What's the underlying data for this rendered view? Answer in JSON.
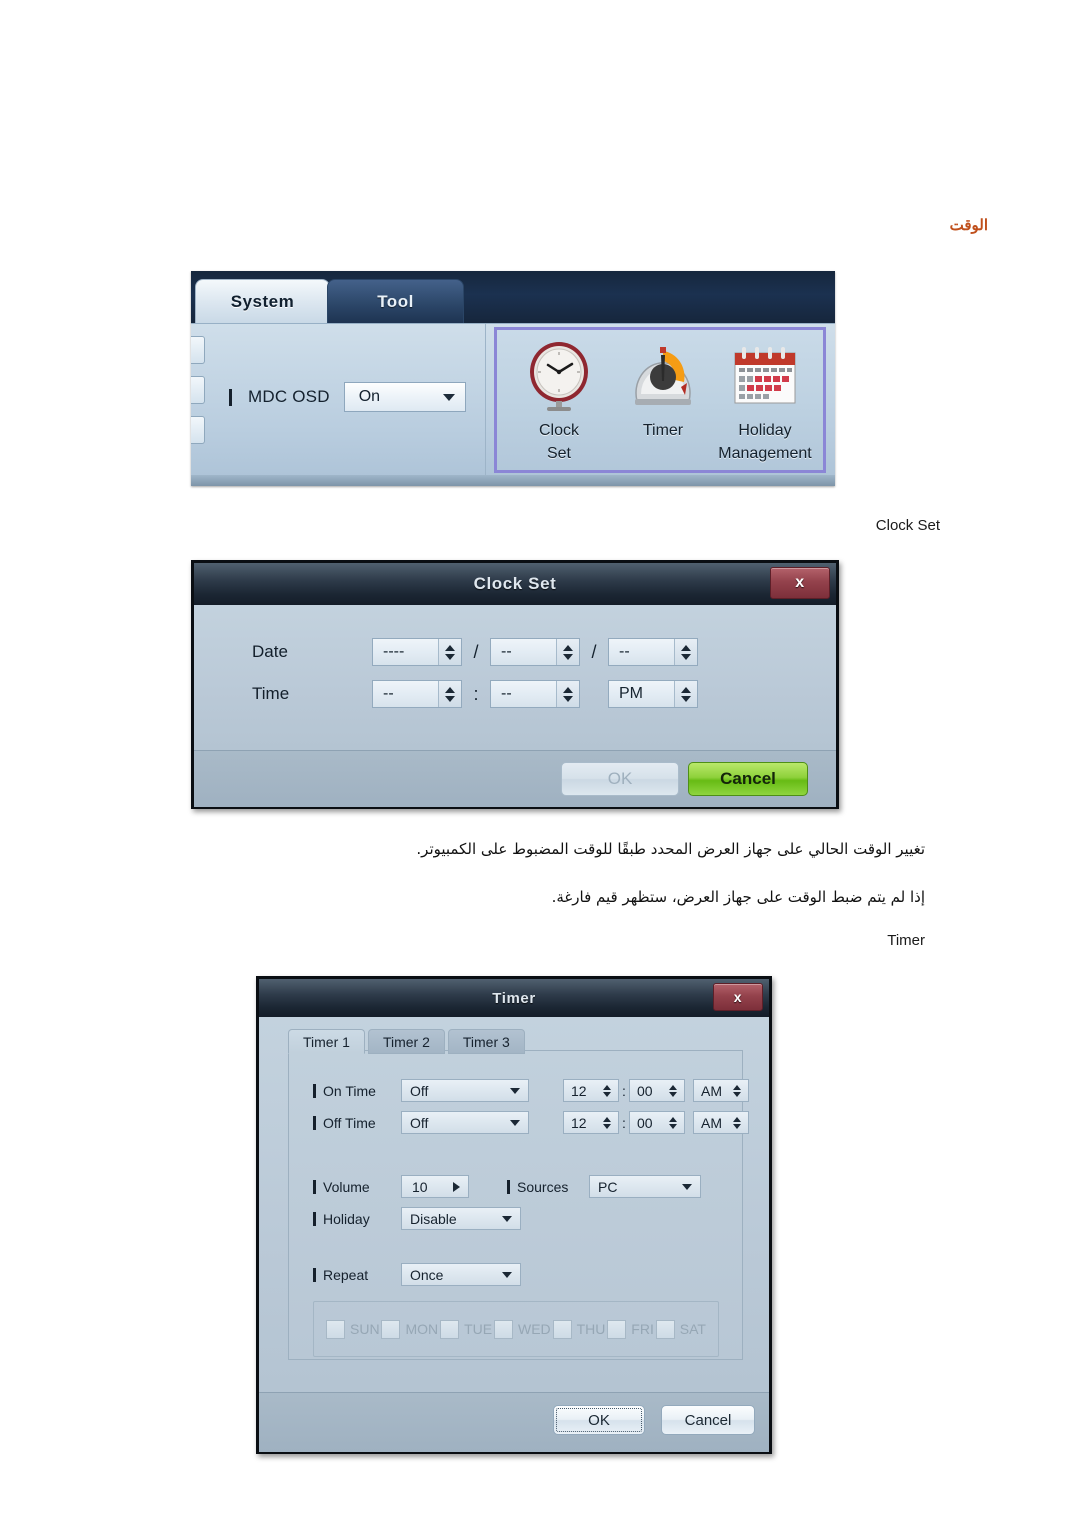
{
  "page": {
    "section_title": "الوقت",
    "caption_clock_set": "Clock Set",
    "caption_timer": "Timer",
    "paragraph_1": "تغيير الوقت الحالي على جهاز العرض المحدد طبقًا للوقت المضبوط على الكمبيوتر.",
    "paragraph_2": "إذا لم يتم ضبط الوقت على جهاز العرض، ستظهر قيم فارغة.",
    "accent_color": "#c0501c"
  },
  "ribbon": {
    "tabs": [
      {
        "label": "System",
        "selected": true
      },
      {
        "label": "Tool",
        "selected": false
      }
    ],
    "mdc_osd": {
      "label": "MDC OSD",
      "value": "On",
      "arrow_icon": "chevron-down-icon"
    },
    "group_highlight_color": "#8b86d6",
    "icons": [
      {
        "name": "clock-set-icon",
        "label_line1": "Clock",
        "label_line2": "Set"
      },
      {
        "name": "timer-icon",
        "label_line1": "Timer",
        "label_line2": ""
      },
      {
        "name": "holiday-management-icon",
        "label_line1": "Holiday",
        "label_line2": "Management"
      }
    ]
  },
  "clock_set_dialog": {
    "title": "Clock Set",
    "close_label": "x",
    "date": {
      "label": "Date",
      "year": "----",
      "month": "--",
      "day": "--",
      "separator": "/"
    },
    "time": {
      "label": "Time",
      "hour": "--",
      "minute": "--",
      "meridiem": "PM",
      "separator": ":"
    },
    "buttons": {
      "ok": "OK",
      "ok_enabled": false,
      "cancel": "Cancel",
      "cancel_color": "#7fc81e"
    }
  },
  "timer_dialog": {
    "title": "Timer",
    "close_label": "x",
    "tabs": [
      {
        "label": "Timer 1",
        "selected": true
      },
      {
        "label": "Timer 2",
        "selected": false
      },
      {
        "label": "Timer 3",
        "selected": false
      }
    ],
    "on_time": {
      "label": "On Time",
      "mode": "Off",
      "hour": "12",
      "minute": "00",
      "meridiem": "AM",
      "separator": ":"
    },
    "off_time": {
      "label": "Off Time",
      "mode": "Off",
      "hour": "12",
      "minute": "00",
      "meridiem": "AM",
      "separator": ":"
    },
    "volume": {
      "label": "Volume",
      "value": "10"
    },
    "sources": {
      "label": "Sources",
      "value": "PC"
    },
    "holiday": {
      "label": "Holiday",
      "value": "Disable"
    },
    "repeat": {
      "label": "Repeat",
      "value": "Once"
    },
    "days": [
      {
        "label": "SUN",
        "checked": false
      },
      {
        "label": "MON",
        "checked": false
      },
      {
        "label": "TUE",
        "checked": false
      },
      {
        "label": "WED",
        "checked": false
      },
      {
        "label": "THU",
        "checked": false
      },
      {
        "label": "FRI",
        "checked": false
      },
      {
        "label": "SAT",
        "checked": false
      }
    ],
    "buttons": {
      "ok": "OK",
      "cancel": "Cancel"
    }
  }
}
